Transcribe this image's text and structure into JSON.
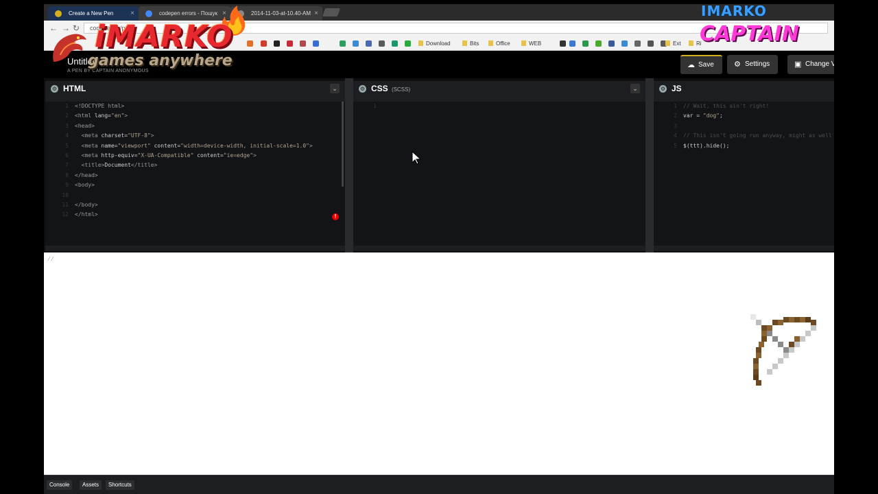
{
  "browser": {
    "tabs": [
      {
        "title": "Create a New Pen",
        "fav": "#d4b020"
      },
      {
        "title": "codepen errors - Пошук",
        "fav": "#4285f4"
      },
      {
        "title": "2014-11-03-at-10.40-AM",
        "fav": "#888888"
      }
    ],
    "close_glyph": "×",
    "url": "codepen.io/pen/",
    "bookmarks": [
      "Download",
      "Bits",
      "Office",
      "WEB",
      "Ext",
      "Ri"
    ]
  },
  "pen": {
    "title": "Untitled",
    "byline": "A PEN BY CAPTAIN ANONYMOUS"
  },
  "header_buttons": {
    "save": "Save",
    "settings": "Settings",
    "change_view": "Change V"
  },
  "panes": {
    "html": {
      "title": "HTML",
      "sub": ""
    },
    "css": {
      "title": "CSS",
      "sub": "(SCSS)"
    },
    "js": {
      "title": "JS",
      "sub": ""
    }
  },
  "html_code": [
    [
      [
        "tag",
        "<!DOCTYPE html>"
      ]
    ],
    [
      [
        "tag",
        "<html "
      ],
      [
        "attr",
        "lang="
      ],
      [
        "str",
        "\"en\""
      ],
      [
        "tag",
        ">"
      ]
    ],
    [
      [
        "tag",
        "<head>"
      ]
    ],
    [
      [
        "tag",
        "  <meta "
      ],
      [
        "attr",
        "charset="
      ],
      [
        "str",
        "\"UTF-8\""
      ],
      [
        "tag",
        ">"
      ]
    ],
    [
      [
        "tag",
        "  <meta "
      ],
      [
        "attr",
        "name="
      ],
      [
        "str",
        "\"viewport\""
      ],
      [
        "attr",
        " content="
      ],
      [
        "str",
        "\"width=device-width, initial-scale=1.0\""
      ],
      [
        "tag",
        ">"
      ]
    ],
    [
      [
        "tag",
        "  <meta "
      ],
      [
        "attr",
        "http-equiv="
      ],
      [
        "str",
        "\"X-UA-Compatible\""
      ],
      [
        "attr",
        " content="
      ],
      [
        "str",
        "\"ie=edge\""
      ],
      [
        "tag",
        ">"
      ]
    ],
    [
      [
        "tag",
        "  <title>"
      ],
      [
        "attr",
        "Document"
      ],
      [
        "tag",
        "</title>"
      ]
    ],
    [
      [
        "tag",
        "</head>"
      ]
    ],
    [
      [
        "tag",
        "<body>"
      ]
    ],
    [],
    [
      [
        "tag",
        "</body>"
      ]
    ],
    [
      [
        "tag",
        "</html>"
      ]
    ]
  ],
  "js_code": [
    [
      [
        "cm",
        "// Wait, this ain't right!"
      ]
    ],
    [
      [
        "attr",
        "var = "
      ],
      [
        "str",
        "\"dog\""
      ],
      [
        "attr",
        ";"
      ]
    ],
    [],
    [
      [
        "cm",
        "// This isn't going run anyway, might as well"
      ]
    ],
    [
      [
        "attr",
        "$(ttt).hide();"
      ]
    ]
  ],
  "preview_text": "//",
  "footer": {
    "console": "Console",
    "assets": "Assets",
    "shortcuts": "Shortcuts"
  },
  "overlay": {
    "logo_main": "iMARKO",
    "logo_tagline": "games anywhere",
    "logo_corner_top": "IMARKO",
    "logo_corner_bottom": "CAPTAIN"
  }
}
